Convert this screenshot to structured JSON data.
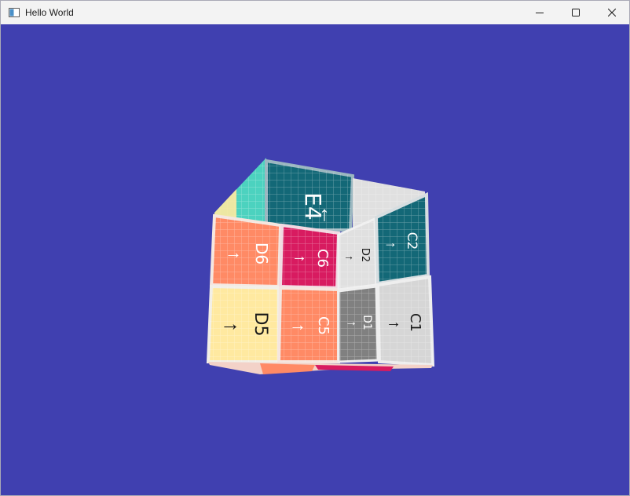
{
  "window": {
    "title": "Hello World",
    "background": "#4040b0"
  },
  "titlebar": {
    "app_icon": "app-window-icon",
    "minimize_icon": "minimize-icon",
    "maximize_icon": "maximize-icon",
    "close_icon": "close-icon"
  },
  "cube": {
    "top_faces": [
      {
        "label": "E4",
        "color": "#136877"
      }
    ],
    "front_faces": [
      {
        "label": "D6",
        "color": "#ff8a65"
      },
      {
        "label": "C6",
        "color": "#d81b60"
      },
      {
        "label": "D5",
        "color": "#ffe9a0"
      },
      {
        "label": "C5",
        "color": "#ff8a65"
      }
    ],
    "right_faces": [
      {
        "label": "D2",
        "color": "#e0e0e0"
      },
      {
        "label": "C2",
        "color": "#136877"
      },
      {
        "label": "D1",
        "color": "#808080"
      },
      {
        "label": "C1",
        "color": "#d6d6d6"
      }
    ],
    "colors": {
      "teal": "#136877",
      "mint": "#4cd2bf",
      "coral": "#ff8a65",
      "magenta": "#d81b60",
      "cream": "#ffe9a0",
      "light_gray": "#e0e0e0",
      "gray": "#808080"
    }
  }
}
